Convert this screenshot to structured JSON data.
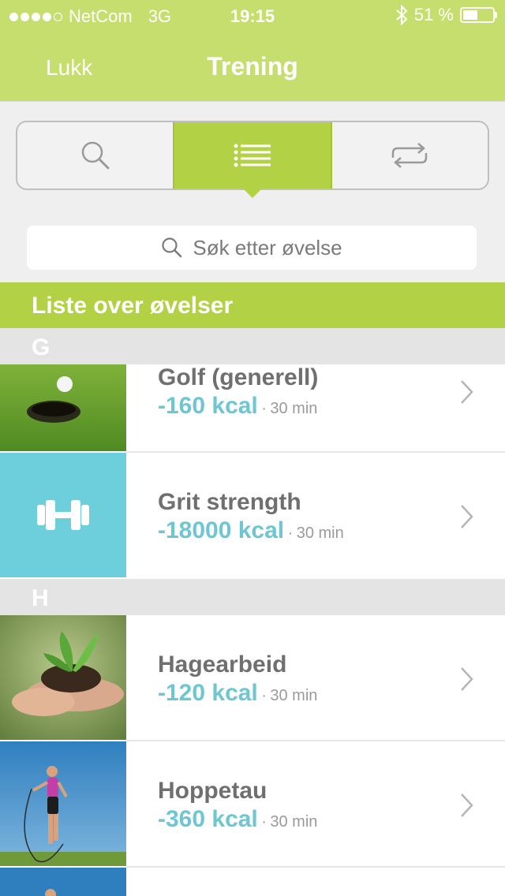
{
  "status_bar": {
    "carrier": "NetCom",
    "network": "3G",
    "time": "19:15",
    "battery_text": "51 %",
    "battery_level": 0.51
  },
  "nav": {
    "close_label": "Lukk",
    "title": "Trening"
  },
  "tabs": [
    {
      "icon": "search-icon",
      "active": false
    },
    {
      "icon": "list-icon",
      "active": true
    },
    {
      "icon": "repeat-icon",
      "active": false
    }
  ],
  "search": {
    "placeholder": "Søk etter øvelse"
  },
  "list_heading": "Liste over øvelser",
  "sections": [
    {
      "letter": "G",
      "items": [
        {
          "name": "Golf (generell)",
          "kcal": "-160 kcal",
          "duration": "30 min",
          "thumb": "golf-photo"
        },
        {
          "name": "Grit strength",
          "kcal": "-18000 kcal",
          "duration": "30 min",
          "thumb": "dumbbell-icon"
        }
      ]
    },
    {
      "letter": "H",
      "items": [
        {
          "name": "Hagearbeid",
          "kcal": "-120 kcal",
          "duration": "30 min",
          "thumb": "gardening-photo"
        },
        {
          "name": "Hoppetau",
          "kcal": "-360 kcal",
          "duration": "30 min",
          "thumb": "jump-rope-photo"
        }
      ]
    }
  ],
  "separator": "·",
  "colors": {
    "header": "#c6de6d",
    "accent": "#b3d144",
    "kcal": "#6fc6d3",
    "dumbbell_bg": "#6ecfdc"
  }
}
